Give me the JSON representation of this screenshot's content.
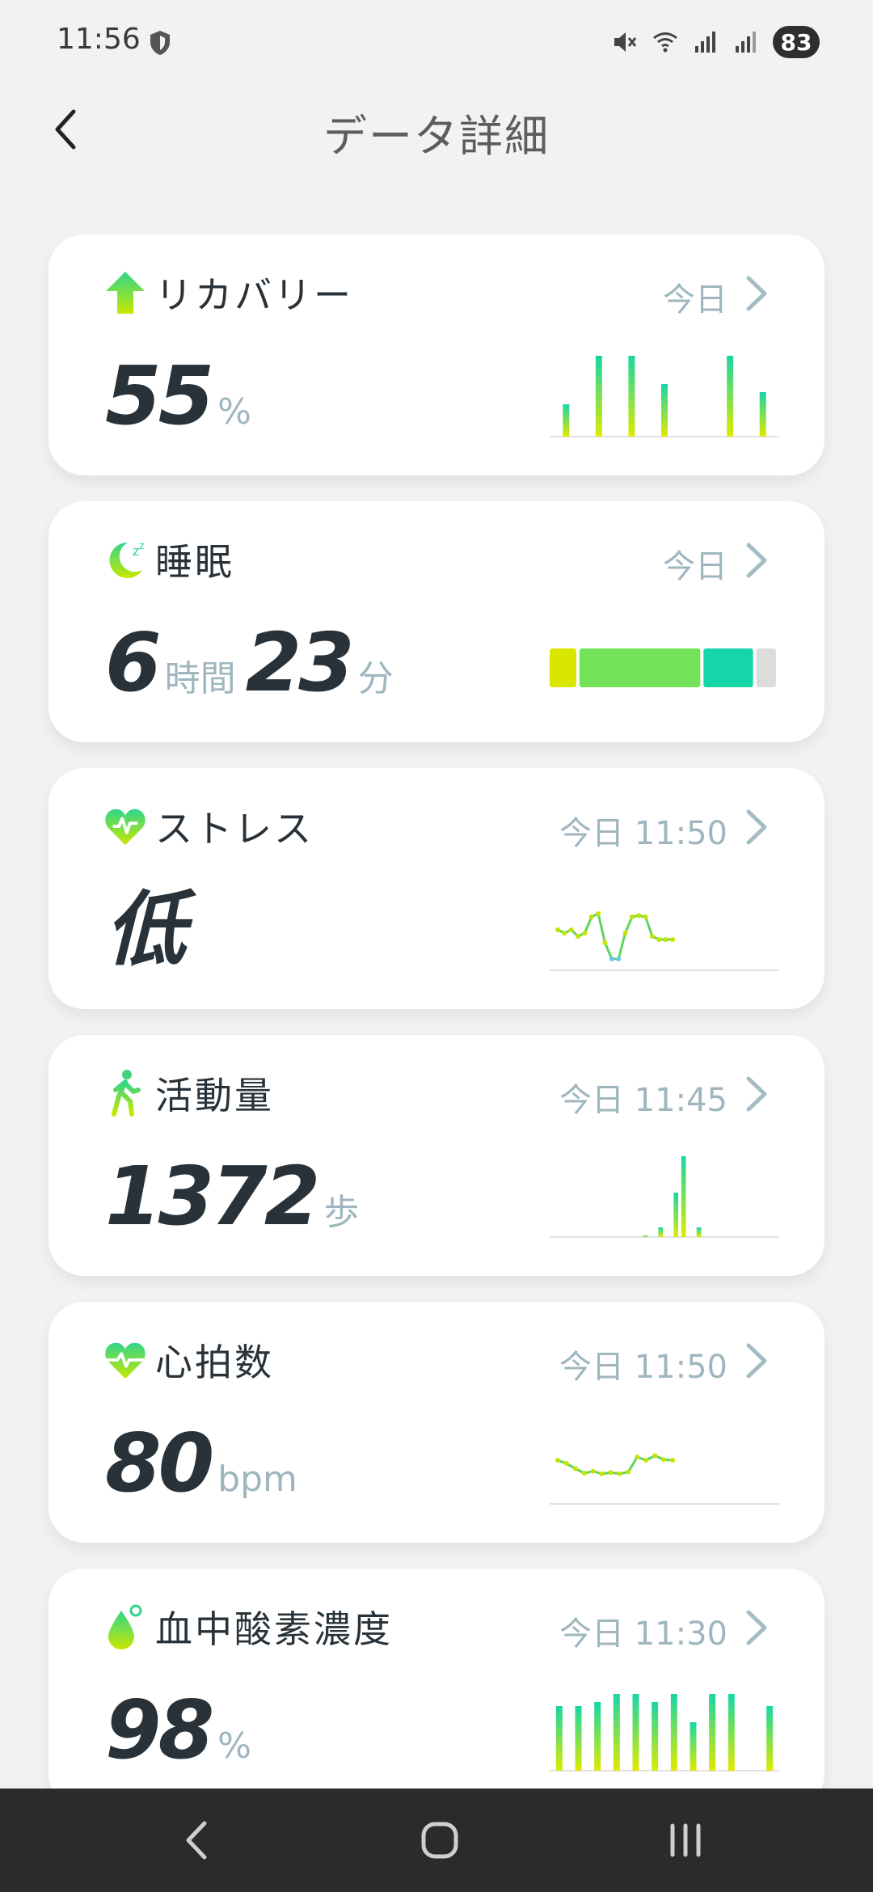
{
  "status_bar": {
    "time": "11:56",
    "battery": "83",
    "icons": [
      "shield-icon",
      "mute-icon",
      "wifi-icon",
      "signal-icon",
      "signal-icon",
      "battery-icon"
    ]
  },
  "header": {
    "title": "データ詳細",
    "back_icon": "chevron-left-icon"
  },
  "colors": {
    "background": "#f2f2f2",
    "card": "#ffffff",
    "text_dark": "#283238",
    "text_muted": "#9fb6bf",
    "accent_green": "#5ed65e",
    "accent_yellow": "#d9e600",
    "accent_teal": "#15d6a8",
    "stress_blue": "#6ec6ee",
    "nav_bar": "#2b2b2b"
  },
  "cards": [
    {
      "key": "recovery",
      "title": "リカバリー",
      "time": "今日",
      "icon": "arrow-up-icon",
      "value": "55",
      "unit": "%",
      "chart": {
        "type": "bar",
        "values": [
          0.4,
          1.0,
          1.0,
          0.65,
          0,
          1.0,
          0.55
        ]
      }
    },
    {
      "key": "sleep",
      "title": "睡眠",
      "time": "今日",
      "icon": "moon-icon",
      "hours": "6",
      "hours_unit": "時間",
      "minutes": "23",
      "minutes_unit": "分",
      "chart": {
        "type": "segments",
        "segments": [
          {
            "color": "#d9e600",
            "fraction": 0.13
          },
          {
            "color": "#72e25a",
            "fraction": 0.54
          },
          {
            "color": "#15d6a8",
            "fraction": 0.23
          },
          {
            "color": "#dcdcdc",
            "fraction": 0.1
          }
        ]
      }
    },
    {
      "key": "stress",
      "title": "ストレス",
      "time": "今日 11:50",
      "icon": "heart-pulse-icon",
      "value": "低",
      "chart": {
        "type": "line",
        "values": [
          0.5,
          0.45,
          0.5,
          0.4,
          0.45,
          0.7,
          0.75,
          0.3,
          0.05,
          0.05,
          0.45,
          0.7,
          0.72,
          0.7,
          0.4,
          0.35,
          0.35,
          0.35
        ]
      }
    },
    {
      "key": "activity",
      "title": "活動量",
      "time": "今日 11:45",
      "icon": "walking-icon",
      "value": "1372",
      "unit": "歩",
      "chart": {
        "type": "bar",
        "values": [
          0,
          0,
          0,
          0,
          0,
          0,
          0,
          0,
          0,
          0,
          0,
          0,
          0.02,
          0,
          0.12,
          0,
          0.55,
          1.0,
          0,
          0.12,
          0,
          0,
          0,
          0,
          0,
          0,
          0,
          0,
          0,
          0
        ]
      }
    },
    {
      "key": "heart_rate",
      "title": "心拍数",
      "time": "今日 11:50",
      "icon": "heartbeat-icon",
      "value": "80",
      "unit": "bpm",
      "chart": {
        "type": "line",
        "values": [
          0.55,
          0.5,
          0.42,
          0.35,
          0.38,
          0.34,
          0.36,
          0.34,
          0.37,
          0.6,
          0.55,
          0.62,
          0.56,
          0.55
        ]
      }
    },
    {
      "key": "spo2",
      "title": "血中酸素濃度",
      "time": "今日 11:30",
      "icon": "droplet-icon",
      "value": "98",
      "unit": "%",
      "chart": {
        "type": "bar",
        "values": [
          0.8,
          0.8,
          0.85,
          0.95,
          0.95,
          0.85,
          0.95,
          0.6,
          0.95,
          0.95,
          0,
          0.8
        ]
      }
    }
  ],
  "nav_bar": {
    "buttons": [
      "back-icon",
      "home-icon",
      "recents-icon"
    ]
  }
}
